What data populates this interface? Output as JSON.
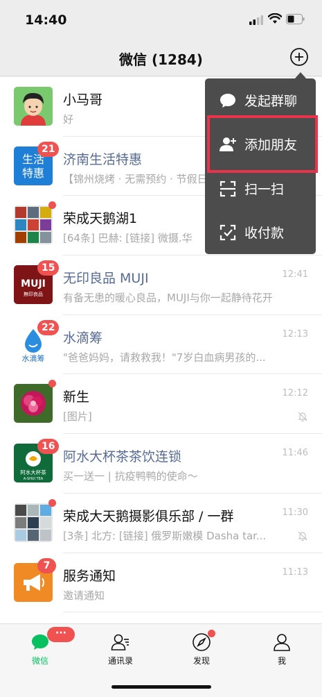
{
  "status": {
    "time": "14:40"
  },
  "nav": {
    "title": "微信 (1284)"
  },
  "menu": {
    "items": [
      {
        "label": "发起群聊",
        "icon": "chat-bubble-icon"
      },
      {
        "label": "添加朋友",
        "icon": "add-friend-icon"
      },
      {
        "label": "扫一扫",
        "icon": "scan-icon"
      },
      {
        "label": "收付款",
        "icon": "payment-icon"
      }
    ]
  },
  "chats": [
    {
      "name": "小马哥",
      "preview": "好",
      "time": "",
      "badge": "",
      "dot": false,
      "muted": false
    },
    {
      "name": "济南生活特惠",
      "preview": "【锦州烧烤 · 无需预约 · 节假日通用】",
      "time": "",
      "badge": "21",
      "dot": false,
      "muted": false
    },
    {
      "name": "荣成天鹅湖1",
      "preview": "[64条] 巴赫: [链接] 微摄.华",
      "time": "",
      "badge": "",
      "dot": true,
      "muted": false
    },
    {
      "name": "无印良品 MUJI",
      "preview": "有备无患的暖心良品，MUJI与你一起静待花开",
      "time": "12:41",
      "badge": "15",
      "dot": false,
      "muted": false
    },
    {
      "name": "水滴筹",
      "preview": "\"爸爸妈妈，请救救我！\"7岁白血病男孩的...",
      "time": "12:13",
      "badge": "22",
      "dot": false,
      "muted": false
    },
    {
      "name": "新生",
      "preview": "[图片]",
      "time": "12:12",
      "badge": "",
      "dot": true,
      "muted": true
    },
    {
      "name": "阿水大杯茶茶饮连锁",
      "preview": "买一送一 | 抗疫鸭鸭的使命～",
      "time": "11:46",
      "badge": "16",
      "dot": false,
      "muted": false
    },
    {
      "name": "荣成大天鹅摄影俱乐部 / 一群",
      "preview": "[3条] 北方: [链接] 俄罗斯嫩模 Dasha tar...",
      "time": "11:30",
      "badge": "",
      "dot": true,
      "muted": true
    },
    {
      "name": "服务通知",
      "preview": "邀请通知",
      "time": "11:13",
      "badge": "7",
      "dot": false,
      "muted": false
    }
  ],
  "avatar_text": {
    "jinan_line1": "生活",
    "jinan_line2": "特惠",
    "muji_logo": "MUJI",
    "muji_sub": "無印良品",
    "shuidi": "水滴筹",
    "ashui": "阿水大杯茶",
    "ashui_sub": "A-SHUI TEA"
  },
  "tabs": [
    {
      "label": "微信",
      "icon": "chat-tab-icon",
      "badge": "···"
    },
    {
      "label": "通讯录",
      "icon": "contacts-tab-icon"
    },
    {
      "label": "发现",
      "icon": "discover-tab-icon"
    },
    {
      "label": "我",
      "icon": "me-tab-icon"
    }
  ],
  "colors": {
    "accent": "#07c160",
    "badge": "#f05251",
    "menu_bg": "#4c4c4c",
    "highlight": "#e8334a",
    "official_name": "#576b95"
  }
}
